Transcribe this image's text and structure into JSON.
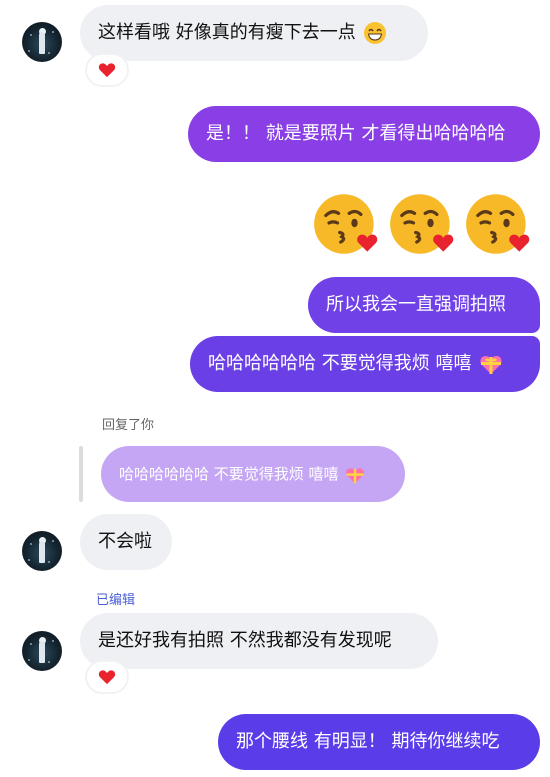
{
  "messages": {
    "m1": {
      "text": "这样看哦  好像真的有瘦下去一点",
      "reaction": "heart-icon"
    },
    "m2": {
      "text": "是！！ 就是要照片 才看得出哈哈哈哈"
    },
    "m3": {
      "emoji": [
        "kissing-face-icon",
        "kissing-face-icon",
        "kissing-face-icon"
      ]
    },
    "m4": {
      "text": "所以我会一直强调拍照"
    },
    "m5": {
      "text": "哈哈哈哈哈哈 不要觉得我烦 嘻嘻"
    },
    "reply": {
      "label": "回复了你",
      "quoted": "哈哈哈哈哈哈 不要觉得我烦 嘻嘻"
    },
    "m6": {
      "text": "不会啦"
    },
    "m7": {
      "edited_label": "已编辑",
      "text": "是还好我有拍照  不然我都没有发现呢",
      "reaction": "heart-icon"
    },
    "m8": {
      "text": "那个腰线 有明显！ 期待你继续吃"
    }
  },
  "colors": {
    "out_bubble_top": "#8a3fe6",
    "out_bubble_bottom": "#5a3de8",
    "in_bubble": "#eef0f3",
    "reply_bubble": "#c4a6f5",
    "edited_label": "#4a5fd6"
  }
}
